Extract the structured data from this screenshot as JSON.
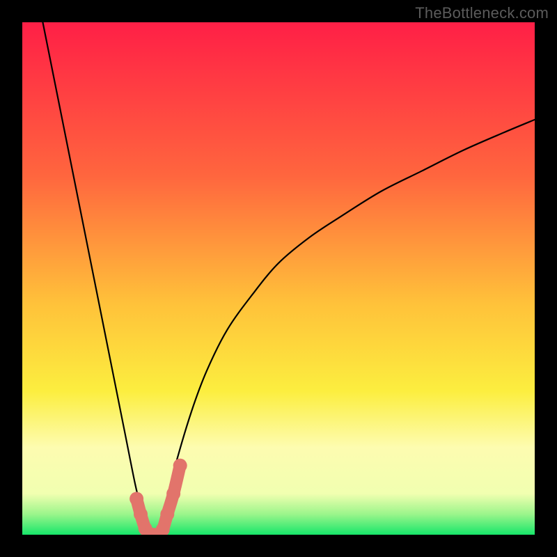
{
  "watermark": "TheBottleneck.com",
  "chart_data": {
    "type": "line",
    "title": "",
    "xlabel": "",
    "ylabel": "",
    "xlim": [
      0,
      100
    ],
    "ylim": [
      0,
      100
    ],
    "grid": false,
    "legend": false,
    "background_gradient": {
      "type": "vertical",
      "stops": [
        {
          "pos": 0.0,
          "color": "#ff1f46"
        },
        {
          "pos": 0.3,
          "color": "#ff663e"
        },
        {
          "pos": 0.55,
          "color": "#ffc23a"
        },
        {
          "pos": 0.72,
          "color": "#fcee3f"
        },
        {
          "pos": 0.83,
          "color": "#fdfcb0"
        },
        {
          "pos": 0.92,
          "color": "#f1ffb0"
        },
        {
          "pos": 0.96,
          "color": "#9bf58b"
        },
        {
          "pos": 1.0,
          "color": "#17e66a"
        }
      ]
    },
    "series": [
      {
        "name": "left-branch",
        "stroke": "#000000",
        "stroke_width": 2.2,
        "x": [
          4,
          6,
          8,
          10,
          12,
          14,
          16,
          18,
          20,
          22,
          23,
          24,
          25,
          26
        ],
        "y": [
          100,
          90,
          80,
          70,
          60,
          50,
          40,
          30,
          20,
          10,
          6,
          3,
          0.5,
          0
        ]
      },
      {
        "name": "right-branch",
        "stroke": "#000000",
        "stroke_width": 2.2,
        "x": [
          26,
          28,
          30,
          33,
          36,
          40,
          45,
          50,
          56,
          62,
          70,
          78,
          86,
          94,
          100
        ],
        "y": [
          0,
          6,
          14,
          24,
          32,
          40,
          47,
          53,
          58,
          62,
          67,
          71,
          75,
          78.5,
          81
        ]
      },
      {
        "name": "marker-cluster",
        "stroke": "#e2746b",
        "marker": "circle",
        "marker_size": 10,
        "x": [
          22.3,
          23.1,
          24.0,
          24.8,
          25.6,
          26.5,
          27.4,
          28.3,
          29.5,
          30.8
        ],
        "y": [
          7.0,
          4.0,
          1.2,
          0.0,
          0.0,
          0.0,
          1.0,
          4.0,
          8.0,
          13.5
        ]
      }
    ]
  }
}
